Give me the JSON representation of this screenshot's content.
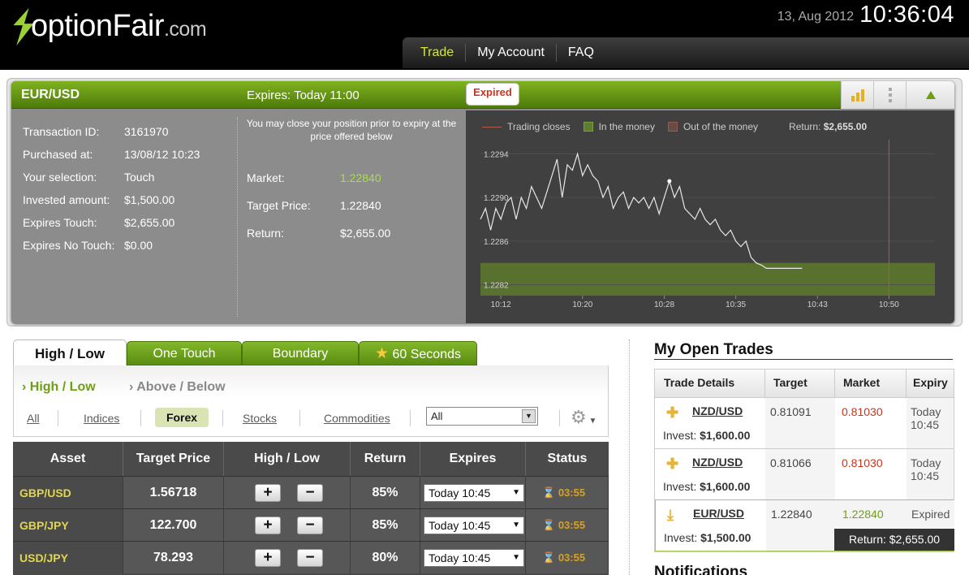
{
  "header": {
    "logo_main": "optionFair",
    "logo_suffix": ".com",
    "date": "13, Aug 2012",
    "time": "10:36:04",
    "nav": [
      "Trade",
      "My Account",
      "FAQ"
    ]
  },
  "panel": {
    "pair": "EUR/USD",
    "expires_label": "Expires:  Today 11:00",
    "status_badge": "Expired",
    "details": [
      {
        "label": "Transaction ID:",
        "value": "3161970"
      },
      {
        "label": "Purchased at:",
        "value": "13/08/12 10:23"
      },
      {
        "label": "Your selection:",
        "value": "Touch"
      },
      {
        "label": "Invested amount:",
        "value": "$1,500.00"
      },
      {
        "label": "Expires Touch:",
        "value": "$2,655.00"
      },
      {
        "label": "Expires No Touch:",
        "value": "$0.00"
      }
    ],
    "close_note": "You may close your position prior to expiry at the price offered below",
    "market_label": "Market:",
    "market_value": "1.22840",
    "target_label": "Target Price:",
    "target_value": "1.22840",
    "return_label": "Return:",
    "return_value": "$2,655.00",
    "colors": {
      "accent_green": "#77a81b",
      "market_green": "#9ad136",
      "expired_red": "#c8341d"
    }
  },
  "chart": {
    "legend": [
      "Trading closes",
      "In the money",
      "Out of the money"
    ],
    "return_label": "Return:",
    "return_value": "$2,655.00",
    "y_ticks": [
      "1.2294",
      "1.2290",
      "1.2286",
      "1.2282"
    ],
    "x_ticks": [
      "10:12",
      "10:20",
      "10:28",
      "10:35",
      "10:43",
      "10:50"
    ]
  },
  "chart_data": {
    "type": "line",
    "ylim": [
      1.2281,
      1.2295
    ],
    "in_the_money_band": [
      1.2281,
      1.2284
    ],
    "trading_closes_time": "10:50",
    "x_minutes": [
      0,
      0.5,
      1,
      1.5,
      2,
      2.5,
      3,
      3.5,
      4,
      4.5,
      5,
      5.5,
      6,
      6.5,
      7,
      7.5,
      8,
      8.5,
      9,
      9.5,
      10,
      10.5,
      11,
      11.5,
      12,
      12.5,
      13,
      13.5,
      14,
      14.5,
      15,
      15.5,
      16,
      16.5,
      17,
      17.5,
      18,
      18.5,
      19,
      19.5,
      20,
      20.5,
      21,
      21.5,
      22,
      22.5,
      23,
      23.5,
      24,
      24.5,
      25,
      25.5,
      26,
      26.5,
      27,
      27.5,
      28,
      28.5,
      29,
      29.5,
      30,
      30.5,
      31,
      31.5
    ],
    "y_values": [
      1.2288,
      1.2289,
      1.2287,
      1.2289,
      1.2288,
      1.22895,
      1.229,
      1.2288,
      1.229,
      1.2289,
      1.2291,
      1.229,
      1.2289,
      1.22905,
      1.2292,
      1.22935,
      1.229,
      1.2293,
      1.22925,
      1.2294,
      1.2292,
      1.2293,
      1.2292,
      1.22915,
      1.229,
      1.2291,
      1.2289,
      1.229,
      1.22905,
      1.2289,
      1.229,
      1.22895,
      1.229,
      1.2289,
      1.229,
      1.22885,
      1.229,
      1.22915,
      1.229,
      1.2291,
      1.2289,
      1.22885,
      1.2288,
      1.2289,
      1.2288,
      1.22875,
      1.2288,
      1.2287,
      1.22865,
      1.2287,
      1.2286,
      1.22855,
      1.2286,
      1.22845,
      1.2284,
      1.22838,
      1.22835,
      1.22835,
      1.22835,
      1.22835,
      1.22835,
      1.22835,
      1.22835,
      1.22835
    ],
    "x_tick_minutes": [
      2,
      10,
      18,
      25,
      33,
      40
    ]
  },
  "product_tabs": [
    "High / Low",
    "One Touch",
    "Boundary",
    "60 Seconds"
  ],
  "sub_tabs": [
    "High / Low",
    "Above / Below"
  ],
  "filters": [
    "All",
    "Indices",
    "Forex",
    "Stocks",
    "Commodities"
  ],
  "filter_select": "All",
  "asset_table": {
    "headers": [
      "Asset",
      "Target Price",
      "High / Low",
      "Return",
      "Expires",
      "Status"
    ],
    "rows": [
      {
        "asset": "GBP/USD",
        "price": "1.56718",
        "return": "85%",
        "expires": "Today 10:45",
        "status": "03:55"
      },
      {
        "asset": "GBP/JPY",
        "price": "122.700",
        "return": "85%",
        "expires": "Today 10:45",
        "status": "03:55"
      },
      {
        "asset": "USD/JPY",
        "price": "78.293",
        "return": "80%",
        "expires": "Today 10:45",
        "status": "03:55"
      }
    ],
    "high_label": "+",
    "low_label": "−"
  },
  "open_trades": {
    "title": "My Open Trades",
    "headers": [
      "Trade Details",
      "Target",
      "Market",
      "Expiry"
    ],
    "invest_label": "Invest:",
    "rows": [
      {
        "pair": "NZD/USD",
        "invest": "$1,600.00",
        "target": "0.81091",
        "market": "0.81030",
        "expiry": "Today 10:45",
        "market_color": "#c8341d"
      },
      {
        "pair": "NZD/USD",
        "invest": "$1,600.00",
        "target": "0.81066",
        "market": "0.81030",
        "expiry": "Today 10:45",
        "market_color": "#c8341d"
      },
      {
        "pair": "EUR/USD",
        "invest": "$1,500.00",
        "target": "1.22840",
        "market": "1.22840",
        "expiry": "Expired",
        "market_color": "#6f9f12"
      }
    ],
    "return_strip": "Return: $2,655.00"
  },
  "notifications_title": "Notifications"
}
